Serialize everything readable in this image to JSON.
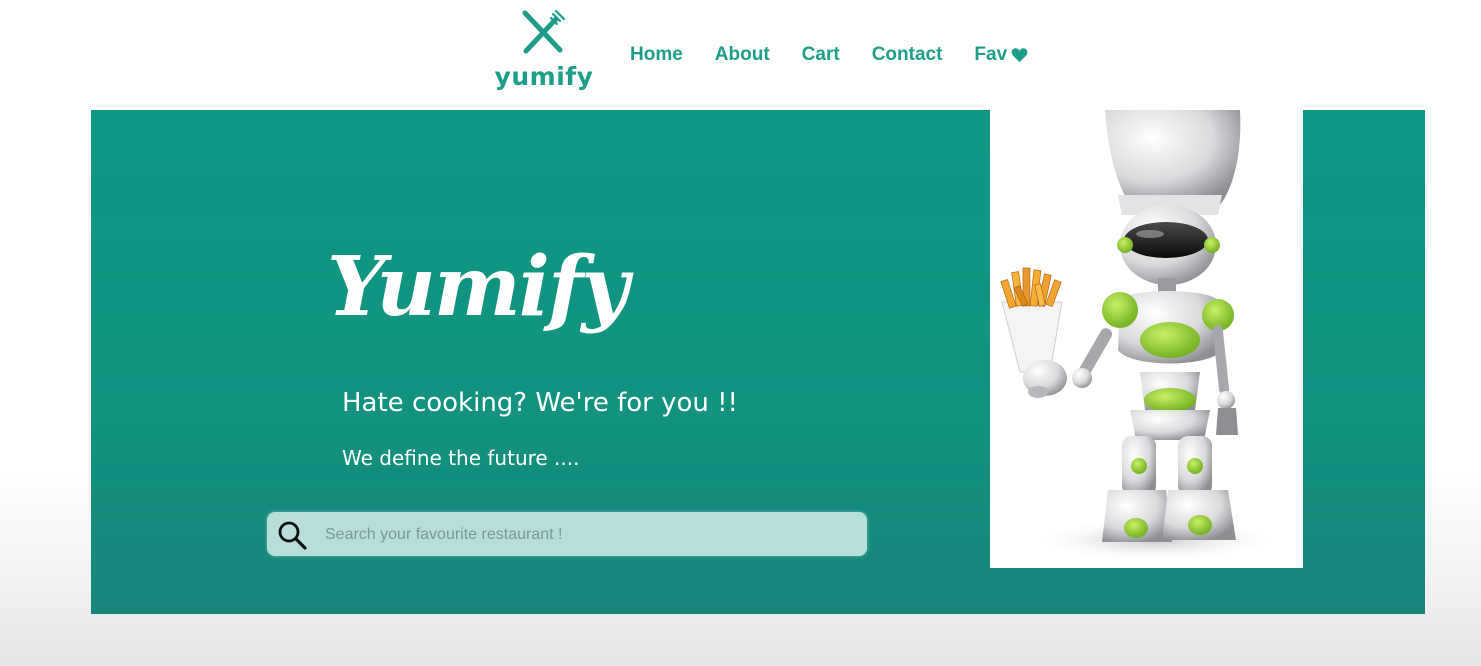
{
  "brand": {
    "logo_text": "yumify",
    "logo_icon": "fork-knife-icon",
    "accent_color": "#1e9e8a"
  },
  "nav": {
    "items": [
      {
        "label": "Home"
      },
      {
        "label": "About"
      },
      {
        "label": "Cart"
      },
      {
        "label": "Contact"
      },
      {
        "label": "Fav",
        "icon": "heart-icon"
      }
    ]
  },
  "hero": {
    "title": "Yumify",
    "tagline": "Hate cooking? We're for you !!",
    "subtitle": "We define the future ....",
    "background_color": "#0e9884",
    "search": {
      "placeholder": "Search your favourite restaurant !",
      "value": "",
      "icon": "search-icon"
    },
    "image": "chef-robot-with-fries-image"
  }
}
